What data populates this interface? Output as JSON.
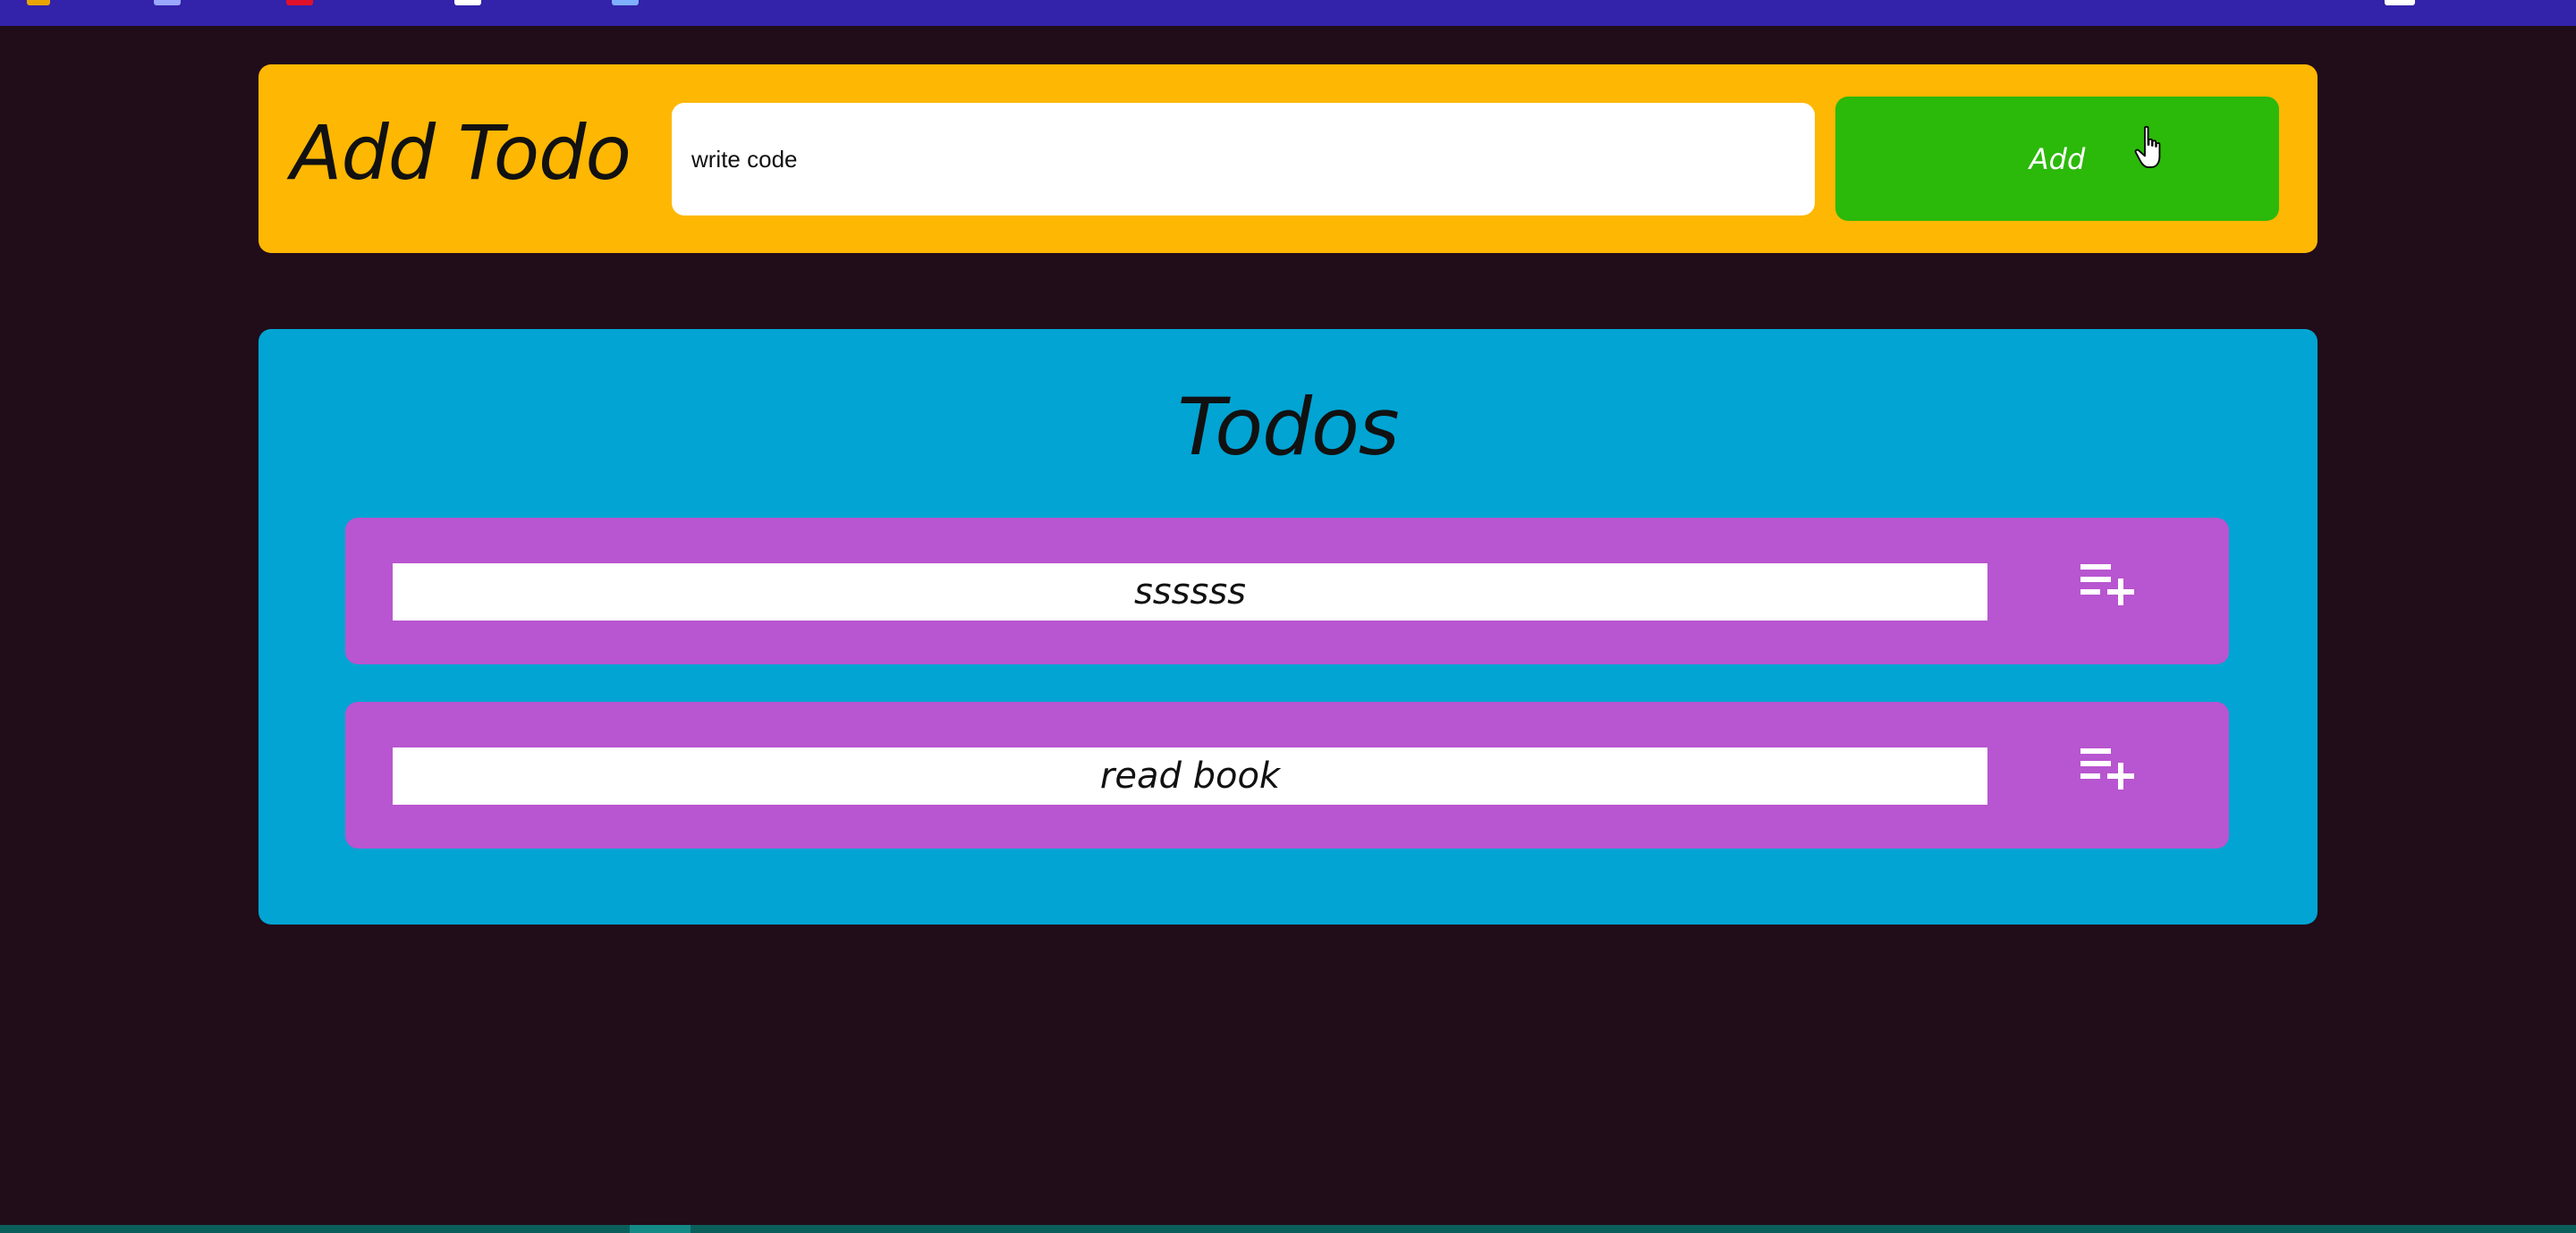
{
  "add_todo": {
    "title": "Add Todo",
    "input_value": "write code",
    "button_label": "Add"
  },
  "todos": {
    "title": "Todos",
    "items": [
      {
        "text": "ssssss",
        "action_icon": "playlist-add-icon"
      },
      {
        "text": "read book",
        "action_icon": "playlist-add-icon"
      }
    ]
  },
  "colors": {
    "background": "#210c1a",
    "add_card": "#feb702",
    "add_button": "#2bb90a",
    "todos_card": "#01a4d3",
    "todo_item": "#b855d0",
    "top_bar": "#3322aa"
  },
  "cursor": {
    "icon": "hand-pointer-icon"
  }
}
